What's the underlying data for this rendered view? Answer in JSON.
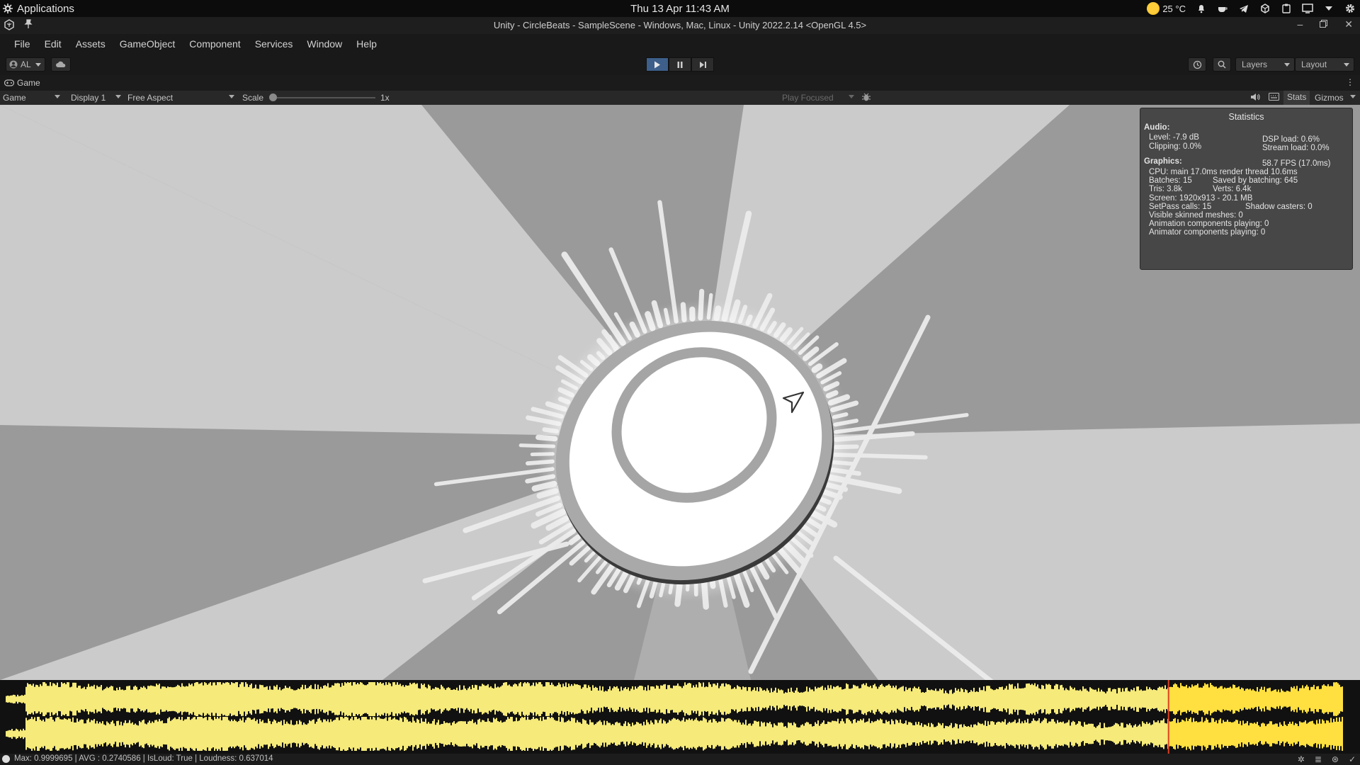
{
  "os_bar": {
    "apps_label": "Applications",
    "clock": "Thu 13 Apr  11:43 AM",
    "temperature": "25 °C",
    "tray_icons": [
      "weather-icon",
      "notification-bell-icon",
      "cup-icon",
      "telegram-icon",
      "cube-icon",
      "clipboard-icon",
      "screen-icon",
      "dropdown-icon",
      "gear-icon"
    ]
  },
  "title_bar": {
    "title": "Unity - CircleBeats - SampleScene - Windows, Mac, Linux - Unity 2022.2.14 <OpenGL 4.5>"
  },
  "menu": {
    "items": [
      "File",
      "Edit",
      "Assets",
      "GameObject",
      "Component",
      "Services",
      "Window",
      "Help"
    ]
  },
  "toolbar": {
    "account_label": "AL",
    "layers_label": "Layers",
    "layout_label": "Layout"
  },
  "tab": {
    "label": "Game"
  },
  "game_controls": {
    "mode": "Game",
    "display": "Display 1",
    "aspect": "Free Aspect",
    "scale_label": "Scale",
    "scale_value": "1x",
    "play_mode": "Play Focused",
    "stats_label": "Stats",
    "gizmos_label": "Gizmos"
  },
  "stats": {
    "title": "Statistics",
    "audio_header": "Audio:",
    "level": "Level: -7.9 dB",
    "dsp_load": "DSP load: 0.6%",
    "clipping": "Clipping: 0.0%",
    "stream_load": "Stream load: 0.0%",
    "graphics_header": "Graphics:",
    "fps": "58.7 FPS (17.0ms)",
    "cpu": "CPU: main 17.0ms  render thread 10.6ms",
    "batches": "Batches: 15",
    "saved_batching": "Saved by batching: 645",
    "tris": "Tris: 3.8k",
    "verts": "Verts: 6.4k",
    "screen": "Screen: 1920x913 - 20.1 MB",
    "setpass": "SetPass calls: 15",
    "shadow_casters": "Shadow casters: 0",
    "skinned": "Visible skinned meshes: 0",
    "animation": "Animation components playing: 0",
    "animator": "Animator components playing: 0"
  },
  "waveform": {
    "wave_color": "#f5ea7a",
    "played_color": "#ffe040",
    "playhead_color": "#e04020",
    "playhead_fraction": 0.87
  },
  "status_bar": {
    "message": "Max: 0.9999695 | AVG : 0.2740586 | IsLoud: True | Loudness: 0.637014"
  }
}
